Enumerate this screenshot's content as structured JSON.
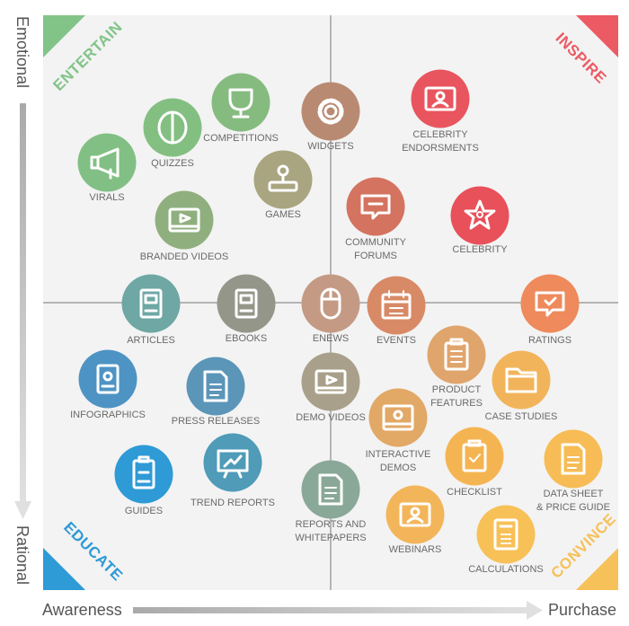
{
  "axes": {
    "y_top": "Emotional",
    "y_bottom": "Rational",
    "x_left": "Awareness",
    "x_right": "Purchase"
  },
  "quadrants": [
    {
      "label": "ENTERTAIN",
      "color": "#82c488"
    },
    {
      "label": "INSPIRE",
      "color": "#ec5a64"
    },
    {
      "label": "EDUCATE",
      "color": "#2e9ad6"
    },
    {
      "label": "CONVINCE",
      "color": "#f7c15a"
    }
  ],
  "items": [
    {
      "label": [
        "VIRALS"
      ],
      "icon": "megaphone-icon",
      "color": "#82bf84"
    },
    {
      "label": [
        "QUIZZES"
      ],
      "icon": "brain-icon",
      "color": "#84bf82"
    },
    {
      "label": [
        "COMPETITIONS"
      ],
      "icon": "trophy-icon",
      "color": "#86bb80"
    },
    {
      "label": [
        "WIDGETS"
      ],
      "icon": "gear-icon",
      "color": "#b98a72"
    },
    {
      "label": [
        "CELEBRITY",
        "ENDORSMENTS"
      ],
      "icon": "presenter-icon",
      "color": "#e8555e"
    },
    {
      "label": [
        "GAMES"
      ],
      "icon": "joystick-icon",
      "color": "#a8a580"
    },
    {
      "label": [
        "BRANDED VIDEOS"
      ],
      "icon": "video-icon",
      "color": "#8fb07e"
    },
    {
      "label": [
        "COMMUNITY",
        "FORUMS"
      ],
      "icon": "chat-icon",
      "color": "#d4735f"
    },
    {
      "label": [
        "CELEBRITY"
      ],
      "icon": "star-icon",
      "color": "#e8505a"
    },
    {
      "label": [
        "ARTICLES"
      ],
      "icon": "article-icon",
      "color": "#6ea7a4"
    },
    {
      "label": [
        "EBOOKS"
      ],
      "icon": "ebook-icon",
      "color": "#95968a"
    },
    {
      "label": [
        "ENEWS"
      ],
      "icon": "mouse-icon",
      "color": "#c49a85"
    },
    {
      "label": [
        "EVENTS"
      ],
      "icon": "calendar-icon",
      "color": "#d88a66"
    },
    {
      "label": [
        "RATINGS"
      ],
      "icon": "rating-chat-icon",
      "color": "#ee8a5c"
    },
    {
      "label": [
        "INFOGRAPHICS"
      ],
      "icon": "infographic-icon",
      "color": "#4d94c4"
    },
    {
      "label": [
        "PRESS RELEASES"
      ],
      "icon": "document-icon",
      "color": "#5b95b8"
    },
    {
      "label": [
        "DEMO VIDEOS"
      ],
      "icon": "video-icon",
      "color": "#a8a08a"
    },
    {
      "label": [
        "PRODUCT",
        "FEATURES"
      ],
      "icon": "clipboard-list-icon",
      "color": "#e0a56c"
    },
    {
      "label": [
        "CASE STUDIES"
      ],
      "icon": "folder-icon",
      "color": "#f2b45a"
    },
    {
      "label": [
        "INTERACTIVE",
        "DEMOS"
      ],
      "icon": "screen-icon",
      "color": "#e2a866"
    },
    {
      "label": [
        "GUIDES"
      ],
      "icon": "guide-icon",
      "color": "#2e9ad6"
    },
    {
      "label": [
        "TREND REPORTS"
      ],
      "icon": "chart-board-icon",
      "color": "#4f9bb8"
    },
    {
      "label": [
        "REPORTS AND",
        "WHITEPAPERS"
      ],
      "icon": "document-icon",
      "color": "#8aa898"
    },
    {
      "label": [
        "CHECKLIST"
      ],
      "icon": "checklist-icon",
      "color": "#f5b452"
    },
    {
      "label": [
        "DATA SHEET",
        "& PRICE GUIDE"
      ],
      "icon": "document-list-icon",
      "color": "#f7bc55"
    },
    {
      "label": [
        "WEBINARS"
      ],
      "icon": "webinar-icon",
      "color": "#f3b55a"
    },
    {
      "label": [
        "CALCULATIONS"
      ],
      "icon": "calculator-icon",
      "color": "#f7c158"
    }
  ]
}
